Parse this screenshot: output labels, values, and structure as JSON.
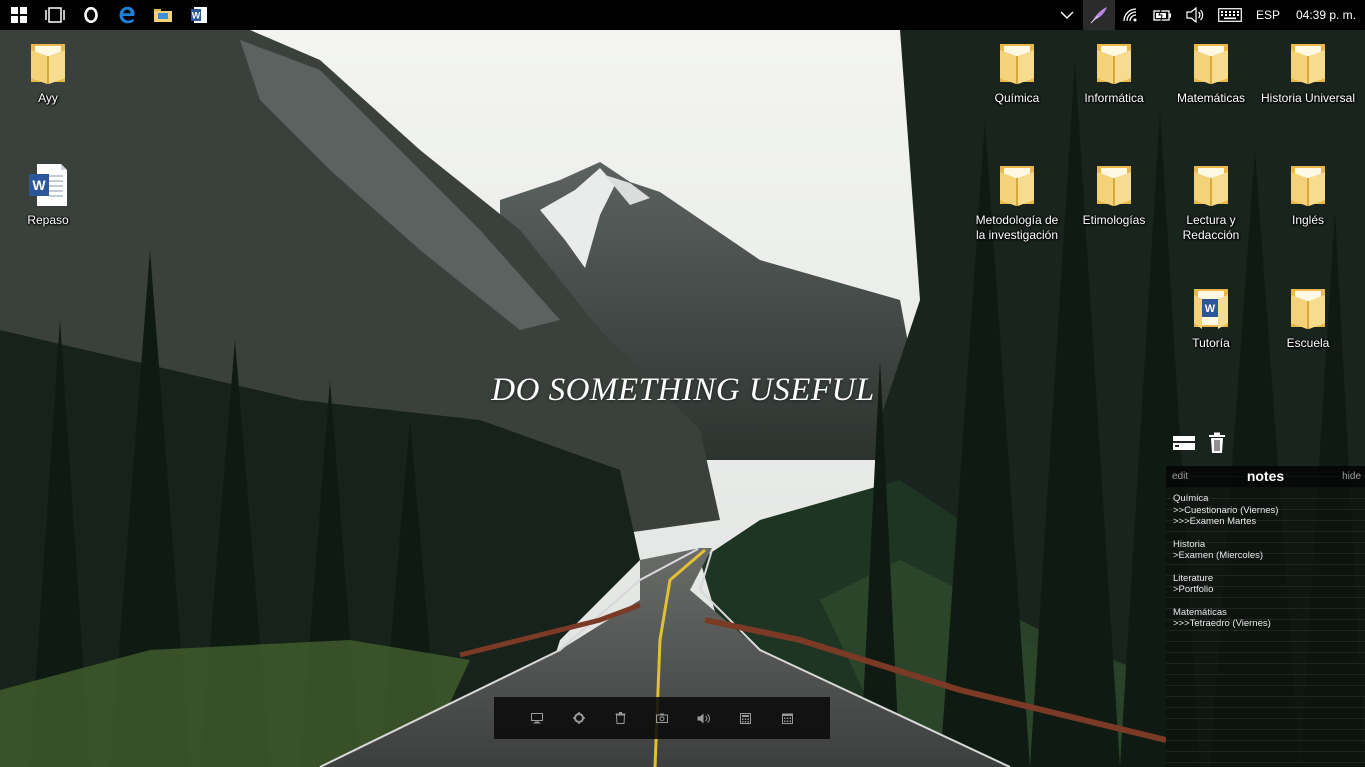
{
  "taskbar": {
    "pinned": [
      {
        "name": "start-button",
        "icon": "windows-logo-icon"
      },
      {
        "name": "task-view-button",
        "icon": "task-view-icon"
      },
      {
        "name": "opera-button",
        "icon": "opera-icon"
      },
      {
        "name": "edge-button",
        "icon": "edge-icon"
      },
      {
        "name": "file-explorer-button",
        "icon": "folder-icon"
      },
      {
        "name": "word-button",
        "icon": "word-icon"
      }
    ],
    "tray": {
      "language": "ESP",
      "clock": "04:39 p. m."
    }
  },
  "desktop": {
    "icons": [
      {
        "label": "Ayy",
        "type": "folder"
      },
      {
        "label": "Repaso",
        "type": "word"
      },
      {
        "label": "Química",
        "type": "folder"
      },
      {
        "label": "Informática",
        "type": "folder"
      },
      {
        "label": "Matemáticas",
        "type": "folder"
      },
      {
        "label": "Historia Universal",
        "type": "folder"
      },
      {
        "label": "Metodología de la investigación",
        "type": "folder"
      },
      {
        "label": "Etimologías",
        "type": "folder"
      },
      {
        "label": "Lectura y Redacción",
        "type": "folder"
      },
      {
        "label": "Inglés",
        "type": "folder"
      },
      {
        "label": "Tutoría",
        "type": "word"
      },
      {
        "label": "Escuela",
        "type": "folder"
      }
    ],
    "motto": "DO SOMETHING USEFUL"
  },
  "notes": {
    "edit_label": "edit",
    "title": "notes",
    "hide_label": "hide",
    "groups": [
      {
        "lines": [
          "Química",
          ">>Cuestionario (Viernes)",
          ">>>Examen Martes"
        ]
      },
      {
        "lines": [
          "Historia",
          ">Examen (Miercoles)"
        ]
      },
      {
        "lines": [
          "Literature",
          ">Portfolio"
        ]
      },
      {
        "lines": [
          "Matemáticas",
          ">>>Tetraedro (Viernes)"
        ]
      }
    ]
  },
  "dock": {
    "buttons": [
      "computer-icon",
      "settings-icon",
      "trash-icon",
      "camera-icon",
      "volume-icon",
      "calculator-icon",
      "calendar-icon"
    ]
  },
  "colors": {
    "taskbar": "#000000",
    "folder": "#f3d27a",
    "word_blue": "#2b579a",
    "edge_blue": "#1e7fd6"
  }
}
